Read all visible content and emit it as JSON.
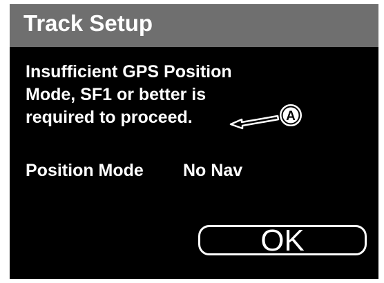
{
  "dialog": {
    "title": "Track Setup",
    "message_lines": [
      "Insufficient GPS Position",
      "Mode, SF1 or better is",
      "required to proceed."
    ],
    "position_mode_label": "Position Mode",
    "position_mode_value": "No Nav",
    "ok_label": "OK"
  },
  "callout": {
    "letter": "A",
    "icon": "callout-arrow-icon"
  },
  "colors": {
    "background": "#000000",
    "title_bar": "#6f6f6f",
    "text": "#ffffff",
    "frame": "#ffffff"
  }
}
